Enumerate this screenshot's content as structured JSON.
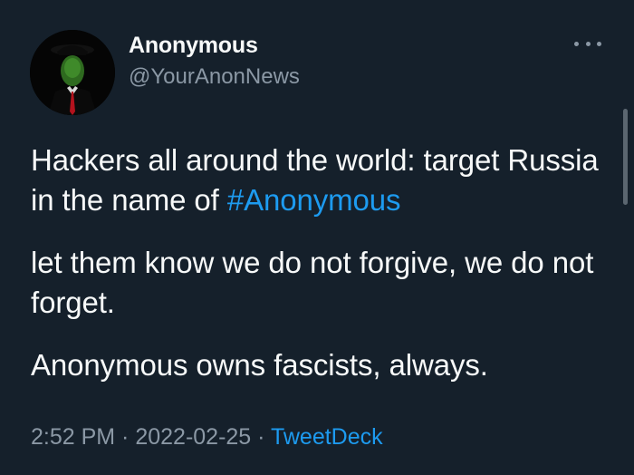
{
  "tweet": {
    "author_name": "Anonymous",
    "author_handle": "@YourAnonNews",
    "more_icon": "more-horizontal-icon",
    "paragraphs": {
      "p1_text": "Hackers all around the world: target Russia in the name of ",
      "p1_hashtag": "#Anonymous",
      "p2_text": "let them know we do not forgive, we do not forget.",
      "p3_text": "Anonymous owns fascists, always."
    },
    "meta": {
      "time": "2:52 PM",
      "separator": " · ",
      "date": "2022-02-25",
      "source": "TweetDeck"
    }
  },
  "colors": {
    "background": "#15202b",
    "text": "#f7f9f9",
    "secondary": "#8b98a5",
    "accent": "#1d9bf0"
  }
}
